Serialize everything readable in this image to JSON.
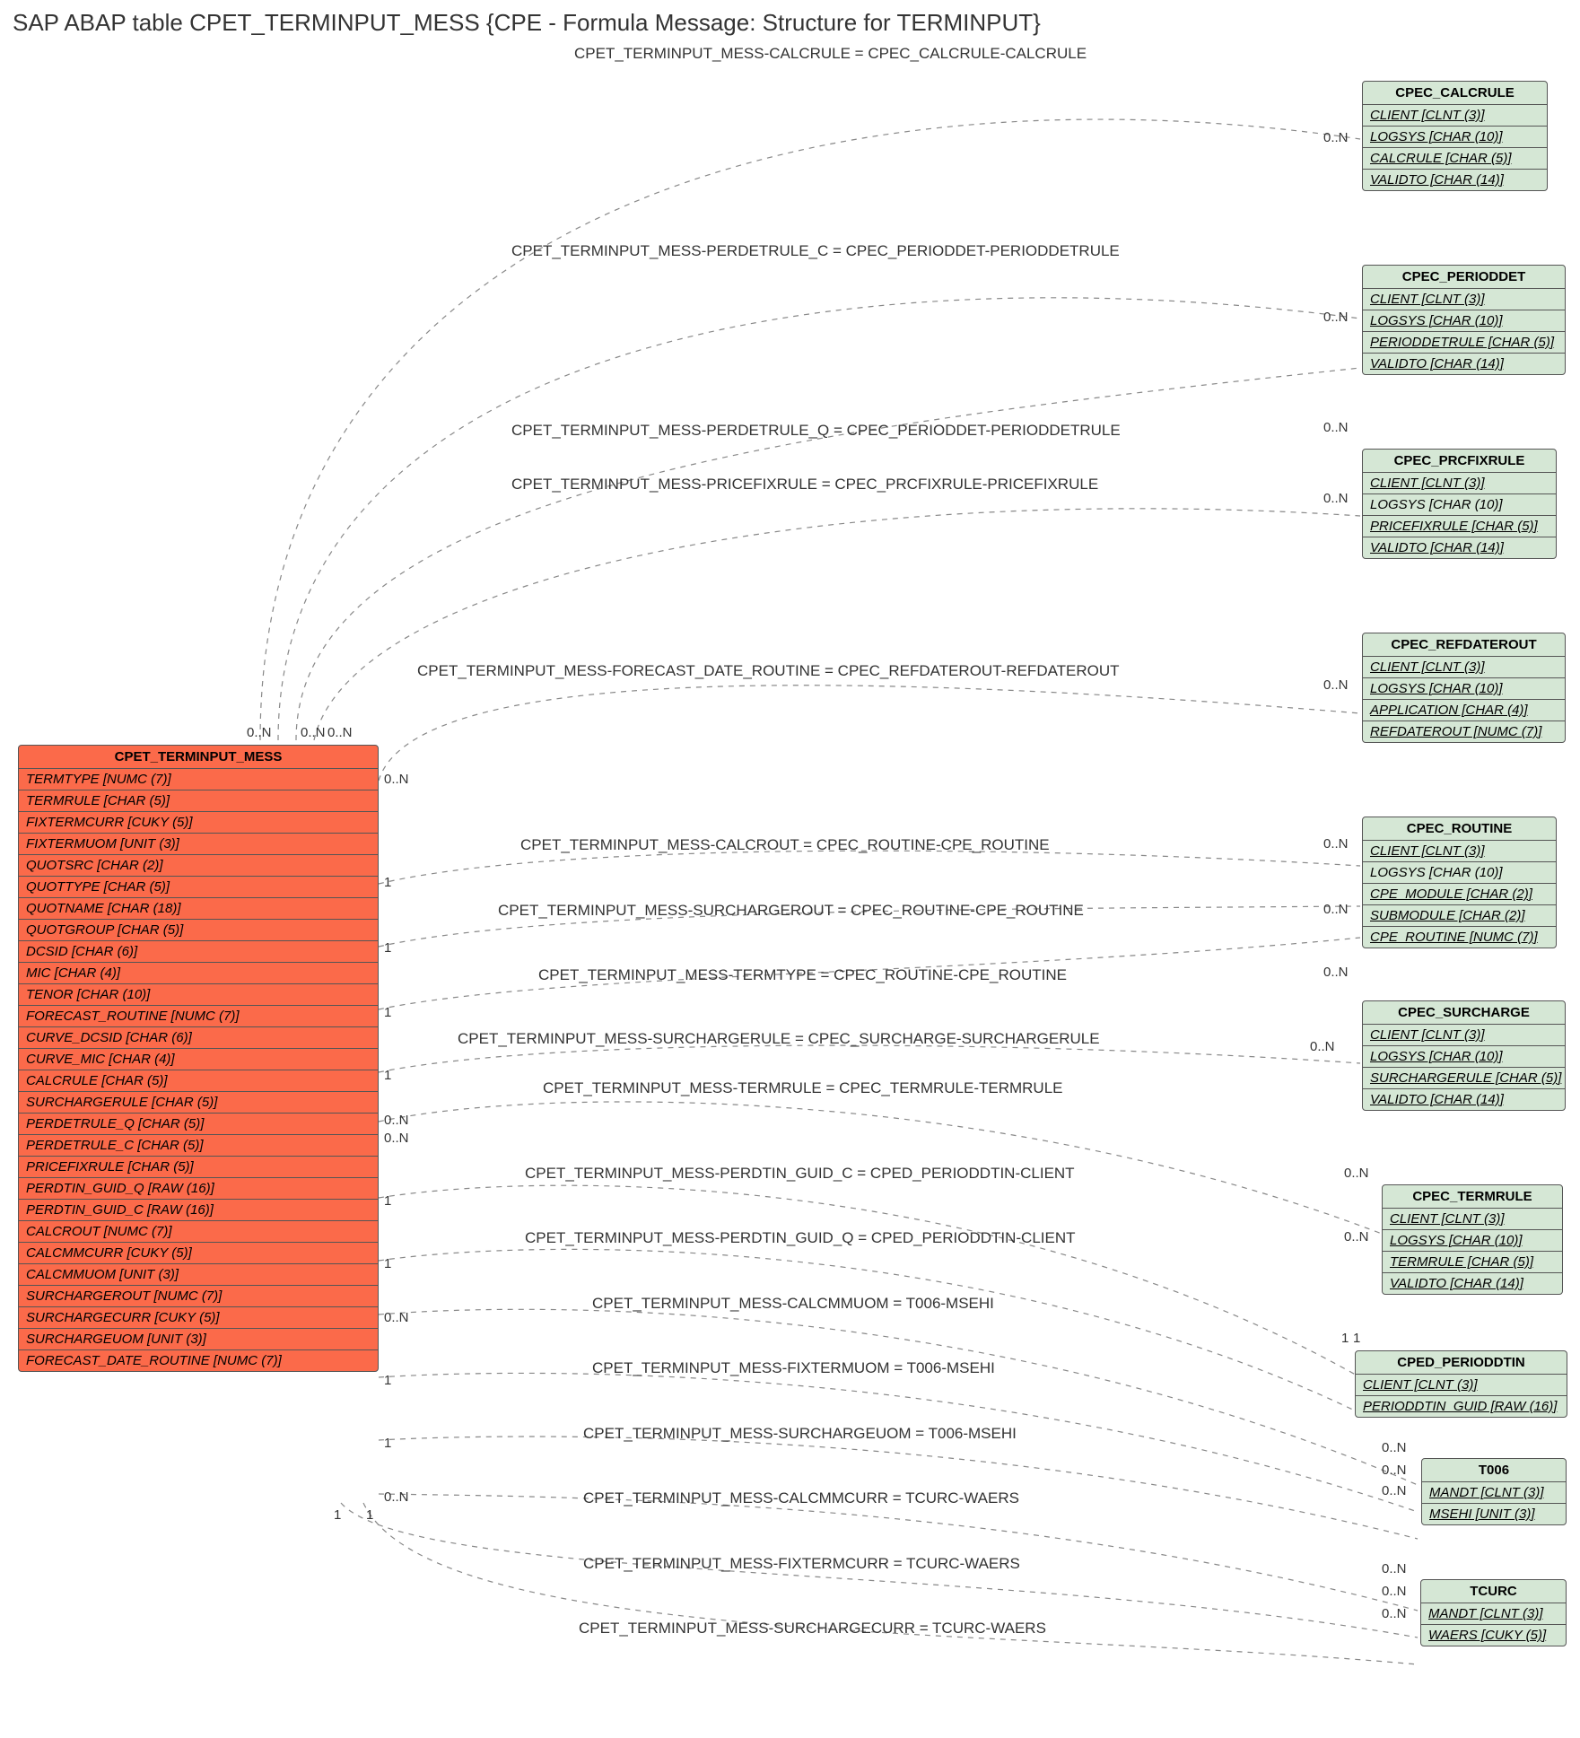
{
  "title": "SAP ABAP table CPET_TERMINPUT_MESS {CPE - Formula Message: Structure for  TERMINPUT}",
  "main_table": {
    "name": "CPET_TERMINPUT_MESS",
    "fields": [
      "TERMTYPE [NUMC (7)]",
      "TERMRULE [CHAR (5)]",
      "FIXTERMCURR [CUKY (5)]",
      "FIXTERMUOM [UNIT (3)]",
      "QUOTSRC [CHAR (2)]",
      "QUOTTYPE [CHAR (5)]",
      "QUOTNAME [CHAR (18)]",
      "QUOTGROUP [CHAR (5)]",
      "DCSID [CHAR (6)]",
      "MIC [CHAR (4)]",
      "TENOR [CHAR (10)]",
      "FORECAST_ROUTINE [NUMC (7)]",
      "CURVE_DCSID [CHAR (6)]",
      "CURVE_MIC [CHAR (4)]",
      "CALCRULE [CHAR (5)]",
      "SURCHARGERULE [CHAR (5)]",
      "PERDETRULE_Q [CHAR (5)]",
      "PERDETRULE_C [CHAR (5)]",
      "PRICEFIXRULE [CHAR (5)]",
      "PERDTIN_GUID_Q [RAW (16)]",
      "PERDTIN_GUID_C [RAW (16)]",
      "CALCROUT [NUMC (7)]",
      "CALCMMCURR [CUKY (5)]",
      "CALCMMUOM [UNIT (3)]",
      "SURCHARGEROUT [NUMC (7)]",
      "SURCHARGECURR [CUKY (5)]",
      "SURCHARGEUOM [UNIT (3)]",
      "FORECAST_DATE_ROUTINE [NUMC (7)]"
    ]
  },
  "ref_tables": [
    {
      "name": "CPEC_CALCRULE",
      "fields": [
        {
          "t": "CLIENT [CLNT (3)]",
          "u": true
        },
        {
          "t": "LOGSYS [CHAR (10)]",
          "u": true
        },
        {
          "t": "CALCRULE [CHAR (5)]",
          "u": true
        },
        {
          "t": "VALIDTO [CHAR (14)]",
          "u": true
        }
      ]
    },
    {
      "name": "CPEC_PERIODDET",
      "fields": [
        {
          "t": "CLIENT [CLNT (3)]",
          "u": true
        },
        {
          "t": "LOGSYS [CHAR (10)]",
          "u": true
        },
        {
          "t": "PERIODDETRULE [CHAR (5)]",
          "u": true
        },
        {
          "t": "VALIDTO [CHAR (14)]",
          "u": true
        }
      ]
    },
    {
      "name": "CPEC_PRCFIXRULE",
      "fields": [
        {
          "t": "CLIENT [CLNT (3)]",
          "u": true
        },
        {
          "t": "LOGSYS [CHAR (10)]",
          "u": false
        },
        {
          "t": "PRICEFIXRULE [CHAR (5)]",
          "u": true
        },
        {
          "t": "VALIDTO [CHAR (14)]",
          "u": true
        }
      ]
    },
    {
      "name": "CPEC_REFDATEROUT",
      "fields": [
        {
          "t": "CLIENT [CLNT (3)]",
          "u": true
        },
        {
          "t": "LOGSYS [CHAR (10)]",
          "u": true
        },
        {
          "t": "APPLICATION [CHAR (4)]",
          "u": true
        },
        {
          "t": "REFDATEROUT [NUMC (7)]",
          "u": true
        }
      ]
    },
    {
      "name": "CPEC_ROUTINE",
      "fields": [
        {
          "t": "CLIENT [CLNT (3)]",
          "u": true
        },
        {
          "t": "LOGSYS [CHAR (10)]",
          "u": false
        },
        {
          "t": "CPE_MODULE [CHAR (2)]",
          "u": true
        },
        {
          "t": "SUBMODULE [CHAR (2)]",
          "u": true
        },
        {
          "t": "CPE_ROUTINE [NUMC (7)]",
          "u": true
        }
      ]
    },
    {
      "name": "CPEC_SURCHARGE",
      "fields": [
        {
          "t": "CLIENT [CLNT (3)]",
          "u": true
        },
        {
          "t": "LOGSYS [CHAR (10)]",
          "u": true
        },
        {
          "t": "SURCHARGERULE [CHAR (5)]",
          "u": true
        },
        {
          "t": "VALIDTO [CHAR (14)]",
          "u": true
        }
      ]
    },
    {
      "name": "CPEC_TERMRULE",
      "fields": [
        {
          "t": "CLIENT [CLNT (3)]",
          "u": true
        },
        {
          "t": "LOGSYS [CHAR (10)]",
          "u": true
        },
        {
          "t": "TERMRULE [CHAR (5)]",
          "u": true
        },
        {
          "t": "VALIDTO [CHAR (14)]",
          "u": true
        }
      ]
    },
    {
      "name": "CPED_PERIODDTIN",
      "fields": [
        {
          "t": "CLIENT [CLNT (3)]",
          "u": true
        },
        {
          "t": "PERIODDTIN_GUID [RAW (16)]",
          "u": true
        }
      ]
    },
    {
      "name": "T006",
      "fields": [
        {
          "t": "MANDT [CLNT (3)]",
          "u": true
        },
        {
          "t": "MSEHI [UNIT (3)]",
          "u": true
        }
      ]
    },
    {
      "name": "TCURC",
      "fields": [
        {
          "t": "MANDT [CLNT (3)]",
          "u": true
        },
        {
          "t": "WAERS [CUKY (5)]",
          "u": true
        }
      ]
    }
  ],
  "relations": [
    "CPET_TERMINPUT_MESS-CALCRULE = CPEC_CALCRULE-CALCRULE",
    "CPET_TERMINPUT_MESS-PERDETRULE_C = CPEC_PERIODDET-PERIODDETRULE",
    "CPET_TERMINPUT_MESS-PERDETRULE_Q = CPEC_PERIODDET-PERIODDETRULE",
    "CPET_TERMINPUT_MESS-PRICEFIXRULE = CPEC_PRCFIXRULE-PRICEFIXRULE",
    "CPET_TERMINPUT_MESS-FORECAST_DATE_ROUTINE = CPEC_REFDATEROUT-REFDATEROUT",
    "CPET_TERMINPUT_MESS-CALCROUT = CPEC_ROUTINE-CPE_ROUTINE",
    "CPET_TERMINPUT_MESS-SURCHARGEROUT = CPEC_ROUTINE-CPE_ROUTINE",
    "CPET_TERMINPUT_MESS-TERMTYPE = CPEC_ROUTINE-CPE_ROUTINE",
    "CPET_TERMINPUT_MESS-SURCHARGERULE = CPEC_SURCHARGE-SURCHARGERULE",
    "CPET_TERMINPUT_MESS-TERMRULE = CPEC_TERMRULE-TERMRULE",
    "CPET_TERMINPUT_MESS-PERDTIN_GUID_C = CPED_PERIODDTIN-CLIENT",
    "CPET_TERMINPUT_MESS-PERDTIN_GUID_Q = CPED_PERIODDTIN-CLIENT",
    "CPET_TERMINPUT_MESS-CALCMMUOM = T006-MSEHI",
    "CPET_TERMINPUT_MESS-FIXTERMUOM = T006-MSEHI",
    "CPET_TERMINPUT_MESS-SURCHARGEUOM = T006-MSEHI",
    "CPET_TERMINPUT_MESS-CALCMMCURR = TCURC-WAERS",
    "CPET_TERMINPUT_MESS-FIXTERMCURR = TCURC-WAERS",
    "CPET_TERMINPUT_MESS-SURCHARGECURR = TCURC-WAERS"
  ],
  "card_labels": {
    "left_cluster": [
      "0..N",
      "0..N",
      "0..N"
    ],
    "forecast_left": "0..N",
    "ones": [
      "1",
      "1",
      "1",
      "1",
      "1",
      "1",
      "1",
      "1",
      "1"
    ],
    "zero_n": [
      "0..N",
      "0..N",
      "0..N",
      "0..N"
    ],
    "bottom_ones": [
      "1",
      "1"
    ],
    "right": [
      "0..N",
      "0..N",
      "0..N",
      "0..N",
      "0..N",
      "0..N",
      "0..N",
      "0..N",
      "0..N",
      "0..N",
      "0..N",
      "1",
      "1",
      "0..N",
      "0..N",
      "0..N",
      "0..N",
      "0..N",
      "0..N"
    ]
  }
}
